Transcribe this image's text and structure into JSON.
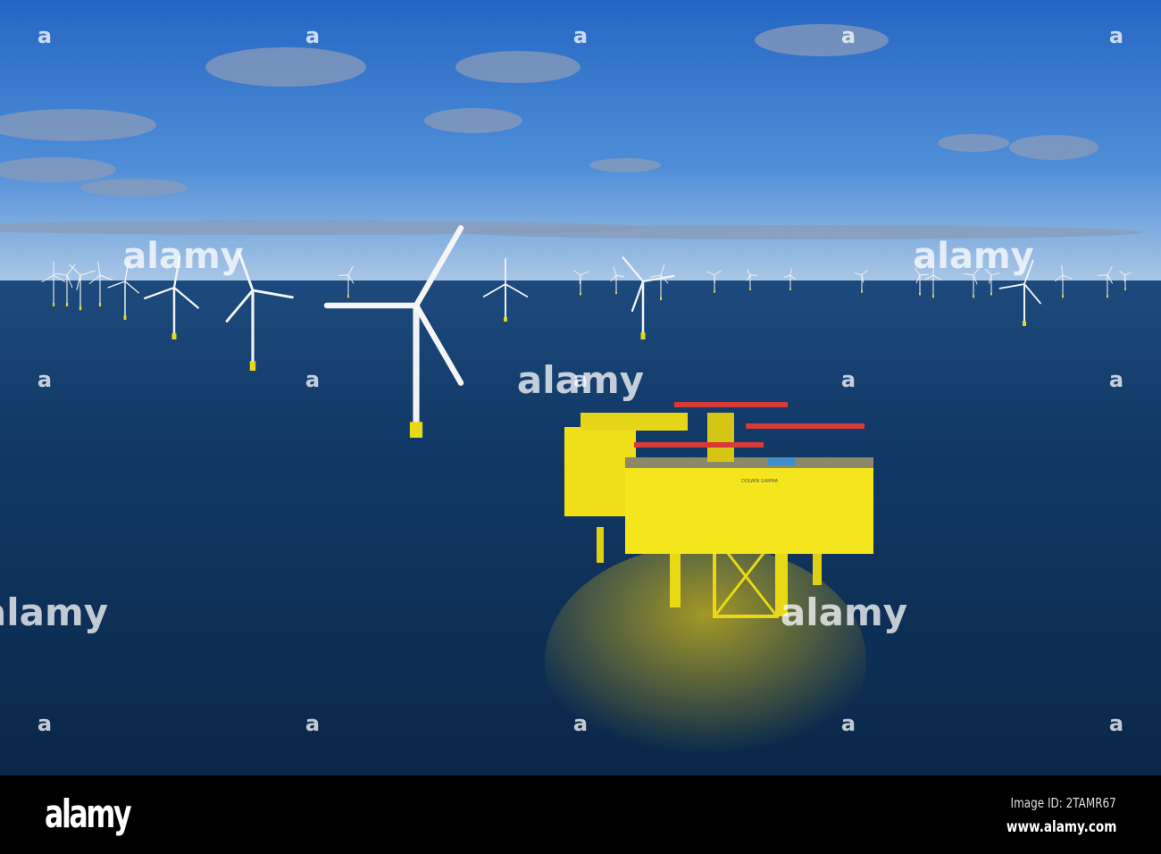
{
  "photo": {
    "subject": "offshore wind farm with yellow converter platform",
    "platform_label": "DOLWIN GAMMA",
    "colors": {
      "sky_top": "#2a6fc9",
      "sky_horizon": "#a9c6e6",
      "sea": "#0e2f57",
      "platform": "#f2e21a"
    }
  },
  "watermark": {
    "text": "alamy",
    "letter": "a"
  },
  "footer": {
    "logo": "alamy",
    "image_id": "Image ID: 2TAMR67",
    "website": "www.alamy.com"
  }
}
